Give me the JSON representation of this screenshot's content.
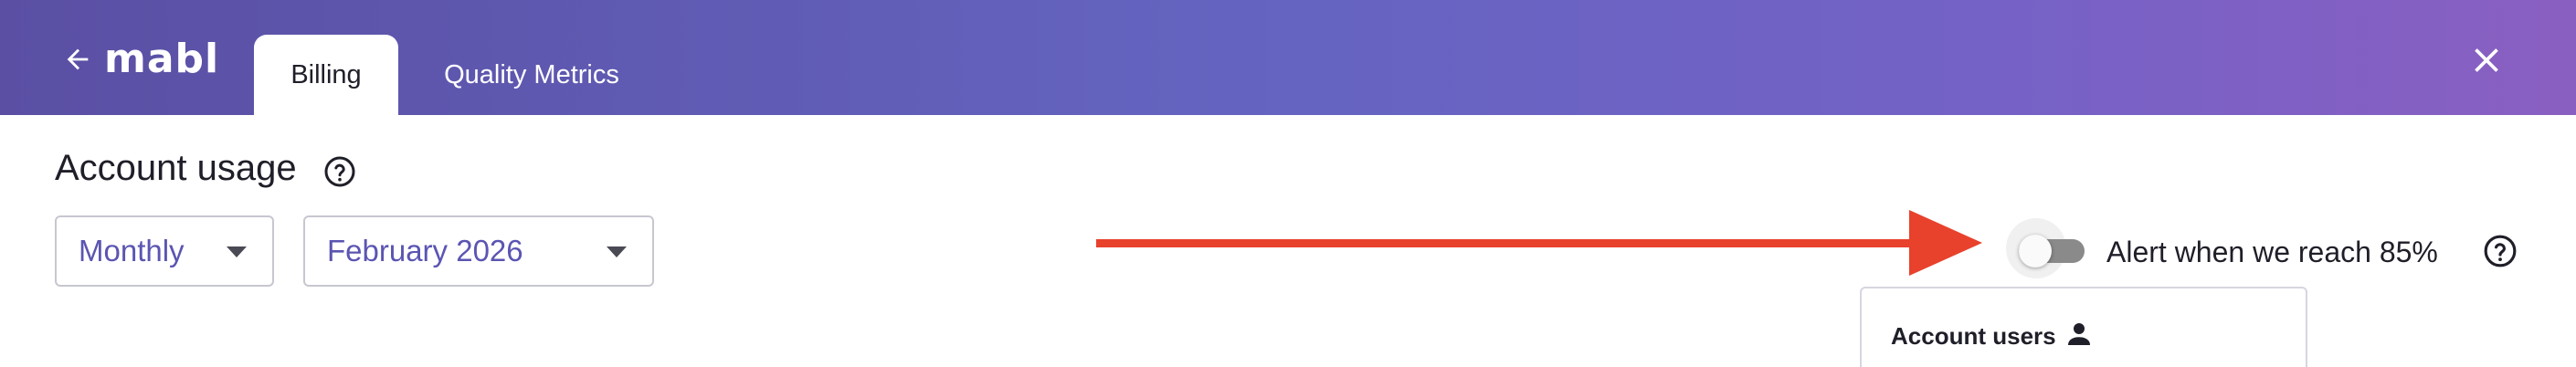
{
  "header": {
    "logo": "mabl",
    "tabs": [
      {
        "label": "Billing",
        "active": true
      },
      {
        "label": "Quality Metrics",
        "active": false
      }
    ],
    "icons": {
      "back": "arrow-left-icon",
      "close": "close-icon"
    },
    "gradient": [
      "#5a4fa3",
      "#6464c0",
      "#8a5fc2"
    ]
  },
  "main": {
    "title": "Account usage",
    "period_select": {
      "value": "Monthly"
    },
    "month_select": {
      "value": "February 2026"
    },
    "alert": {
      "label": "Alert when we reach 85%",
      "enabled": false
    },
    "users_card": {
      "title": "Account users"
    }
  },
  "colors": {
    "accent": "#5b55b2",
    "arrow": "#e8412c",
    "text": "#1f1f29"
  }
}
